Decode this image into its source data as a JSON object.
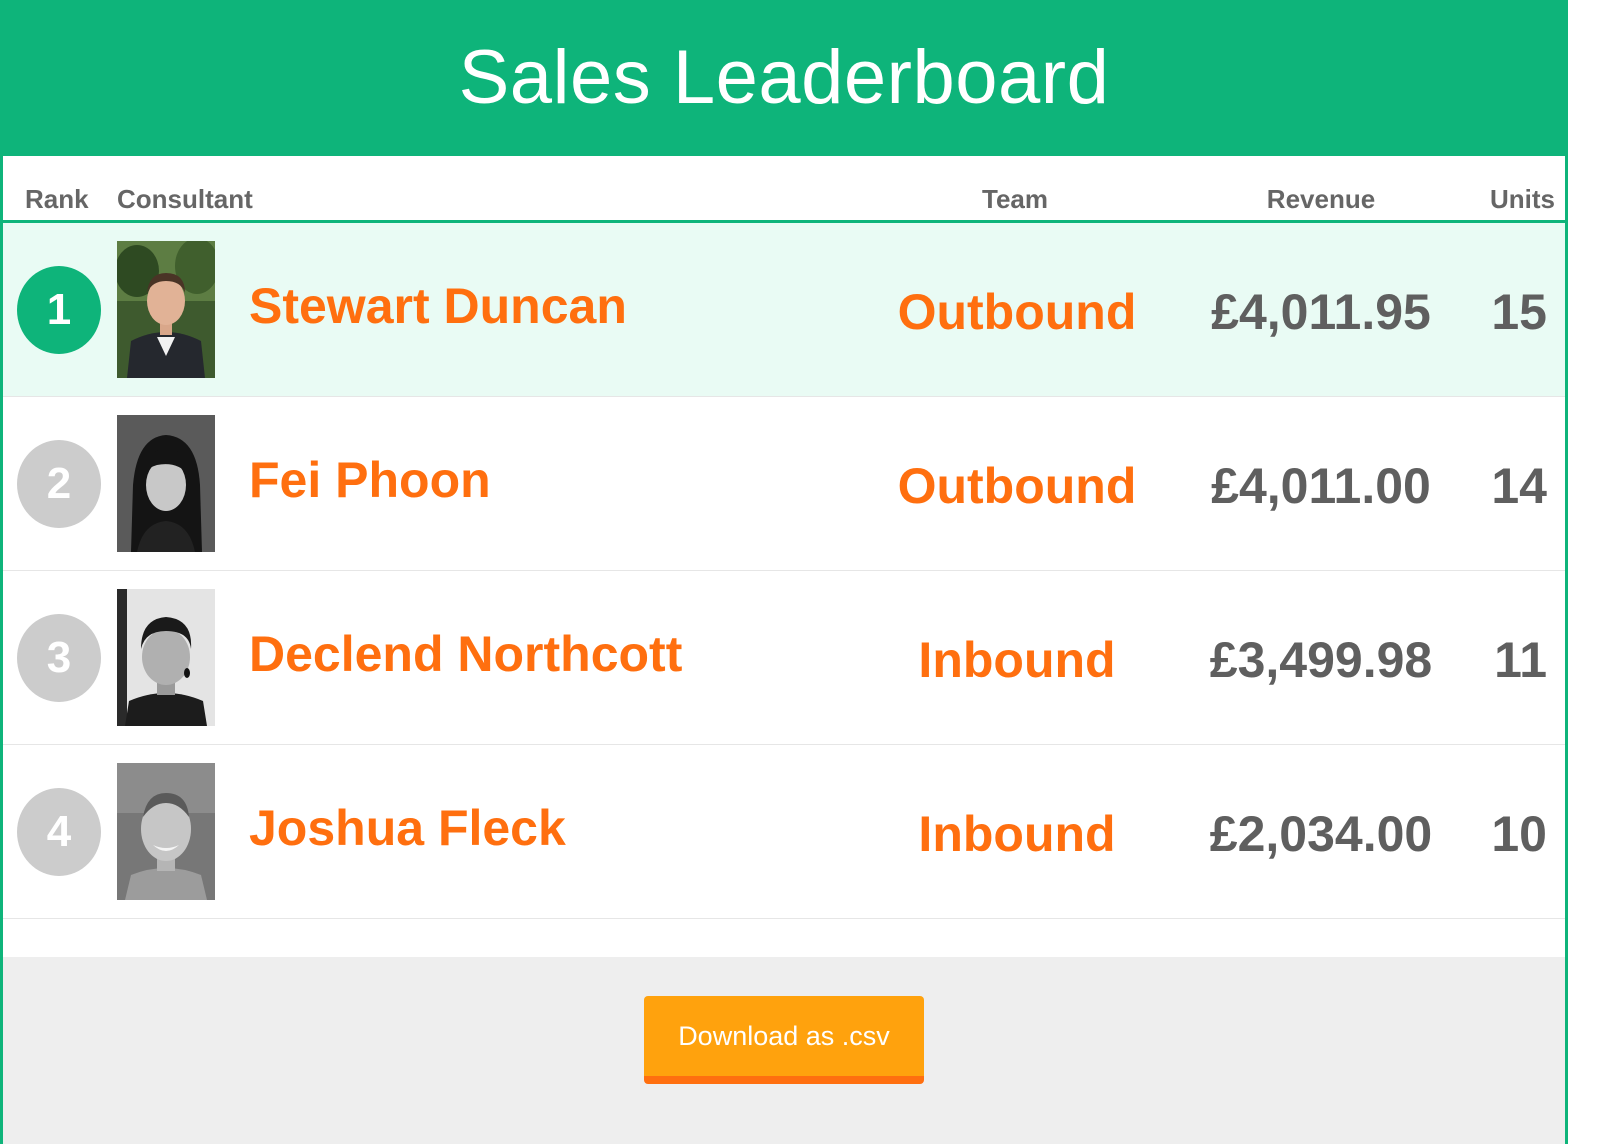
{
  "header": {
    "title": "Sales Leaderboard"
  },
  "columns": {
    "rank": "Rank",
    "consultant": "Consultant",
    "team": "Team",
    "revenue": "Revenue",
    "units": "Units"
  },
  "rows": [
    {
      "rank": "1",
      "name": "Stewart Duncan",
      "team": "Outbound",
      "revenue": "£4,011.95",
      "units": "15",
      "highlighted": true
    },
    {
      "rank": "2",
      "name": "Fei Phoon",
      "team": "Outbound",
      "revenue": "£4,011.00",
      "units": "14",
      "highlighted": false
    },
    {
      "rank": "3",
      "name": "Declend Northcott",
      "team": "Inbound",
      "revenue": "£3,499.98",
      "units": "11",
      "highlighted": false
    },
    {
      "rank": "4",
      "name": "Joshua Fleck",
      "team": "Inbound",
      "revenue": "£2,034.00",
      "units": "10",
      "highlighted": false
    }
  ],
  "footer": {
    "download_label": "Download as .csv"
  },
  "colors": {
    "brand_green": "#0eb47a",
    "highlight_row": "#e9fbf4",
    "name_orange": "#ff6f0f",
    "value_gray": "#5f5f5f",
    "badge_gray": "#cccccc",
    "button_orange": "#ffa20d"
  }
}
